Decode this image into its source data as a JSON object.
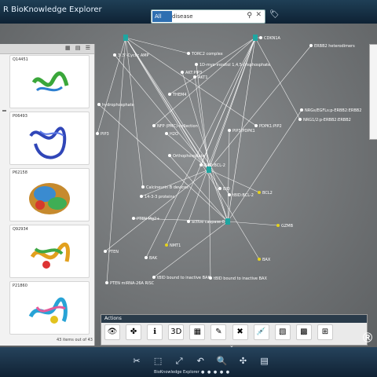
{
  "app": {
    "title": "R BioKnowledge Explorer"
  },
  "search": {
    "scope": "All",
    "query": "disease"
  },
  "graph": {
    "labels": [
      "1D-myo-inositol 1,4,5-trisphosphate",
      "AKT:PIP3",
      "THEM4",
      "PDPK1:PIP2",
      "H2O",
      "Orthophosphate",
      "BAD:BCL-2",
      "Calcineurin B devices",
      "14-3-3 proteins",
      "PTEN Mg2+",
      "active caspase-8",
      "tBID:BCL-2",
      "BCL2",
      "GZMB",
      "NMT1",
      "BAX",
      "tBID bound to inactive BAX",
      "tBID bound to inactive BAK",
      "CDKN1A",
      "TORC2 complex",
      "ERBB2 heterodimers",
      "NRGs/EGFLs:p-ERBB2:ERBB2",
      "NRG1/2:p-ERBB2:ERBB2",
      "PTEN miRNA-26A RISC",
      "3',5'-Cyclic AMP",
      "hydrophosphate",
      "NFP (PMC)-collection",
      "PIP3",
      "AKT1",
      "PIP3:PDPK1",
      "BAK",
      "BID",
      "PTEN"
    ]
  },
  "left_panel": {
    "controls": "▦ ▤ ☰",
    "proteins": [
      "Q14451",
      "P06493",
      "P62158",
      "Q92934",
      "P21860"
    ],
    "count_text": "43 items out of 43"
  },
  "actions": {
    "label": "Actions",
    "buttons": [
      "👁",
      "✤",
      "ℹ",
      "3D",
      "▦",
      "✎",
      "✖",
      "💉",
      "▧",
      "▩",
      "⊞"
    ]
  },
  "toolbar": {
    "buttons": [
      "✂",
      "⬚",
      "⤢",
      "↶",
      "🔍",
      "✣",
      "▤"
    ]
  },
  "bottom": {
    "title": "BioKnowledge Explorer",
    "dots": "● ● ● ● ●"
  },
  "colors": {
    "accent": "#2e6fb1",
    "node": "#1fa6a1",
    "highlight": "#e5d21c"
  }
}
